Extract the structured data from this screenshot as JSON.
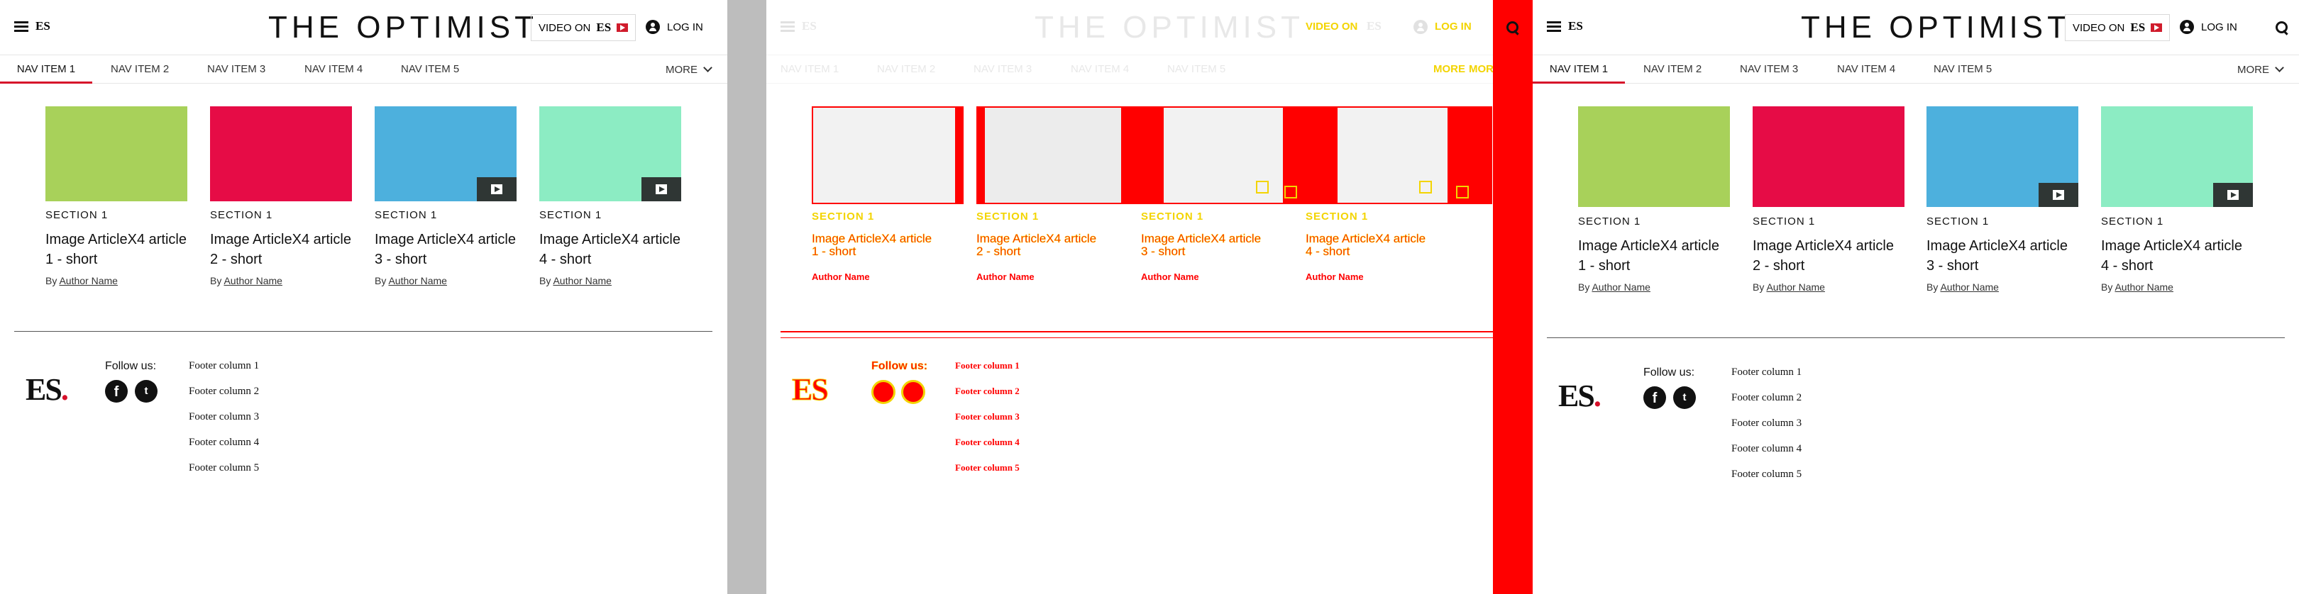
{
  "brand": {
    "menu_label": "ES",
    "title": "THE OPTIMIST",
    "video_label": "VIDEO ON",
    "video_brand": "ES",
    "login_label": "LOG IN",
    "footer_logo": "ES",
    "accent_color": "#d6102a"
  },
  "nav": {
    "items": [
      "NAV ITEM 1",
      "NAV ITEM 2",
      "NAV ITEM 3",
      "NAV ITEM 4",
      "NAV ITEM 5"
    ],
    "more_label": "MORE",
    "active_index": 0
  },
  "articles": [
    {
      "section": "SECTION 1",
      "headline_line1": "Image ArticleX4 article",
      "headline_line2": "1 - short",
      "by": "By",
      "author": "Author Name",
      "color": "#a8d15a",
      "video": false
    },
    {
      "section": "SECTION 1",
      "headline_line1": "Image ArticleX4 article",
      "headline_line2": "2 - short",
      "by": "By",
      "author": "Author Name",
      "color": "#e60c46",
      "video": false
    },
    {
      "section": "SECTION 1",
      "headline_line1": "Image ArticleX4 article",
      "headline_line2": "3 - short",
      "by": "By",
      "author": "Author Name",
      "color": "#4db0dd",
      "video": true
    },
    {
      "section": "SECTION 1",
      "headline_line1": "Image ArticleX4 article",
      "headline_line2": "4 - short",
      "by": "By",
      "author": "Author Name",
      "color": "#8cecc3",
      "video": true
    }
  ],
  "footer": {
    "follow_label": "Follow us:",
    "social": [
      "facebook-icon",
      "twitter-icon"
    ],
    "columns": [
      "Footer column 1",
      "Footer column 2",
      "Footer column 3",
      "Footer column 4",
      "Footer column 5"
    ]
  },
  "overlay": {
    "divider_color": "#bdbdbd",
    "marker_color": "#ff0000",
    "highlight_color": "#f3d400"
  }
}
